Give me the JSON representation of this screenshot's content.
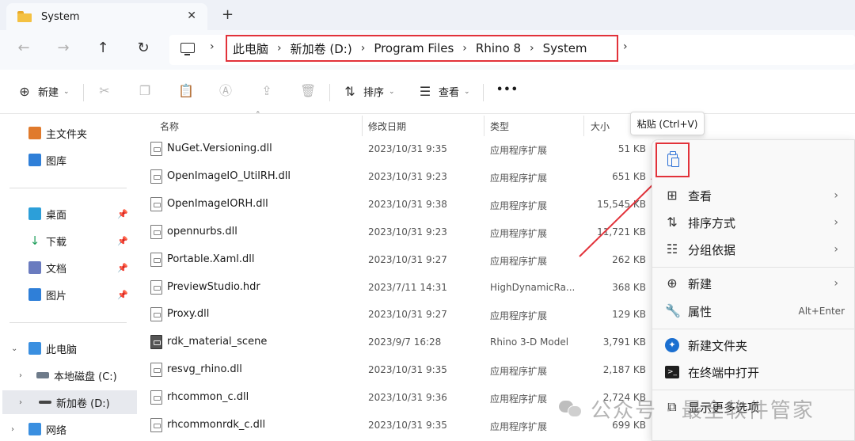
{
  "window": {
    "tab_title": "System"
  },
  "nav": {
    "breadcrumbs": [
      "此电脑",
      "新加卷 (D:)",
      "Program Files",
      "Rhino 8",
      "System"
    ]
  },
  "toolbar": {
    "new_label": "新建",
    "sort_label": "排序",
    "view_label": "查看",
    "more_label": "•••"
  },
  "sidebar": {
    "home": "主文件夹",
    "gallery": "图库",
    "desktop": "桌面",
    "downloads": "下载",
    "documents": "文档",
    "pictures": "图片",
    "this_pc": "此电脑",
    "local_c": "本地磁盘 (C:)",
    "new_volume_d": "新加卷 (D:)",
    "network": "网络"
  },
  "columns": {
    "name": "名称",
    "modified": "修改日期",
    "type": "类型",
    "size": "大小"
  },
  "files": [
    {
      "name": "NuGet.Versioning.dll",
      "date": "2023/10/31 9:35",
      "type": "应用程序扩展",
      "size": "51 KB",
      "icon": "dll-icon"
    },
    {
      "name": "OpenImageIO_UtilRH.dll",
      "date": "2023/10/31 9:23",
      "type": "应用程序扩展",
      "size": "651 KB",
      "icon": "dll-icon"
    },
    {
      "name": "OpenImageIORH.dll",
      "date": "2023/10/31 9:38",
      "type": "应用程序扩展",
      "size": "15,545 KB",
      "icon": "dll-icon"
    },
    {
      "name": "opennurbs.dll",
      "date": "2023/10/31 9:23",
      "type": "应用程序扩展",
      "size": "11,721 KB",
      "icon": "dll-icon"
    },
    {
      "name": "Portable.Xaml.dll",
      "date": "2023/10/31 9:27",
      "type": "应用程序扩展",
      "size": "262 KB",
      "icon": "dll-icon"
    },
    {
      "name": "PreviewStudio.hdr",
      "date": "2023/7/11 14:31",
      "type": "HighDynamicRa...",
      "size": "368 KB",
      "icon": "file-icon"
    },
    {
      "name": "Proxy.dll",
      "date": "2023/10/31 9:27",
      "type": "应用程序扩展",
      "size": "129 KB",
      "icon": "dll-icon"
    },
    {
      "name": "rdk_material_scene",
      "date": "2023/9/7 16:28",
      "type": "Rhino 3-D Model",
      "size": "3,791 KB",
      "icon": "rhino-model-icon"
    },
    {
      "name": "resvg_rhino.dll",
      "date": "2023/10/31 9:35",
      "type": "应用程序扩展",
      "size": "2,187 KB",
      "icon": "dll-icon"
    },
    {
      "name": "rhcommon_c.dll",
      "date": "2023/10/31 9:36",
      "type": "应用程序扩展",
      "size": "2,724 KB",
      "icon": "dll-icon"
    },
    {
      "name": "rhcommonrdk_c.dll",
      "date": "2023/10/31 9:35",
      "type": "应用程序扩展",
      "size": "699 KB",
      "icon": "dll-icon"
    }
  ],
  "tooltip": "粘贴 (Ctrl+V)",
  "context_menu": {
    "view": "查看",
    "sort_by": "排序方式",
    "group_by": "分组依据",
    "new": "新建",
    "properties": "属性",
    "properties_shortcut": "Alt+Enter",
    "new_folder": "新建文件夹",
    "open_terminal": "在终端中打开",
    "more_options": "显示更多选项"
  },
  "watermark": "公众号 · 最全软件管家",
  "colors": {
    "highlight_box": "#e2323a",
    "accent": "#1b6fd0",
    "folder": "#f4c142"
  }
}
